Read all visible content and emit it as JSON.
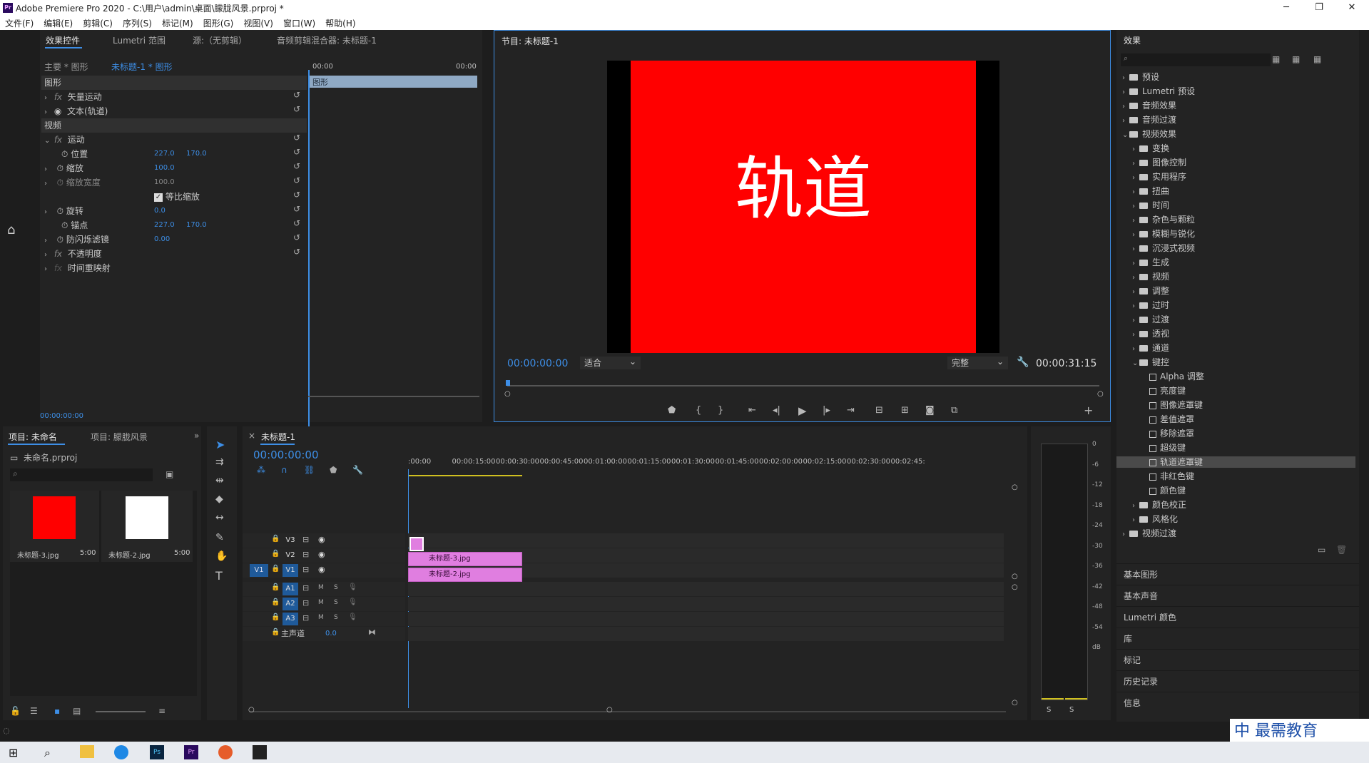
{
  "window": {
    "title": "Adobe Premiere Pro 2020 - C:\\用户\\admin\\桌面\\朦胧风景.prproj *",
    "app_icon": "Pr",
    "min": "─",
    "max": "❐",
    "close": "✕"
  },
  "menu": [
    "文件(F)",
    "编辑(E)",
    "剪辑(C)",
    "序列(S)",
    "标记(M)",
    "图形(G)",
    "视图(V)",
    "窗口(W)",
    "帮助(H)"
  ],
  "left_top_tabs": [
    "效果控件",
    "Lumetri 范围",
    "源:（无剪辑）",
    "音频剪辑混合器: 未标题-1"
  ],
  "effect_controls": {
    "master": "主要 * 图形",
    "sequence": "未标题-1 * 图形",
    "ruler_start": "00:00",
    "ruler_end": "00:00",
    "clip_label": "图形",
    "section_graphics": "图形",
    "vector_motion": "矢量运动",
    "text_item": "文本(轨道)",
    "section_video": "视频",
    "motion": "运动",
    "position": "位置",
    "position_x": "227.0",
    "position_y": "170.0",
    "scale": "缩放",
    "scale_v": "100.0",
    "scale_width": "缩放宽度",
    "scale_width_v": "100.0",
    "uniform_scale": "等比缩放",
    "rotation": "旋转",
    "rotation_v": "0.0",
    "anchor": "锚点",
    "anchor_x": "227.0",
    "anchor_y": "170.0",
    "flicker": "防闪烁滤镜",
    "flicker_v": "0.00",
    "opacity": "不透明度",
    "time_remap": "时间重映射",
    "fx": "fx",
    "timecode": "00:00:00:00"
  },
  "program": {
    "tab": "节目: 未标题-1",
    "text": "轨道",
    "timecode": "00:00:00:00",
    "fit": "适合",
    "quality": "完整",
    "duration": "00:00:31:15",
    "frame_color": "#ff0000"
  },
  "project": {
    "tabs": [
      "项目: 未命名",
      "项目: 朦胧风景"
    ],
    "file": "未命名.prproj",
    "items": [
      {
        "name": "未标题-3.jpg",
        "dur": "5:00",
        "color": "#ff0000"
      },
      {
        "name": "未标题-2.jpg",
        "dur": "5:00",
        "color": "#ffffff"
      }
    ]
  },
  "timeline": {
    "tab": "未标题-1",
    "timecode": "00:00:00:00",
    "ruler": [
      ":00:00",
      "00:00:15:00",
      "00:00:30:00",
      "00:00:45:00",
      "00:01:00:00",
      "00:01:15:00",
      "00:01:30:00",
      "00:01:45:00",
      "00:02:00:00",
      "00:02:15:00",
      "00:02:30:00",
      "00:02:45:"
    ],
    "video_tracks": [
      "V3",
      "V2",
      "V1"
    ],
    "audio_tracks": [
      "A1",
      "A2",
      "A3"
    ],
    "source_patch": "V1",
    "master": "主声道",
    "master_v": "0.0",
    "m": "M",
    "s": "S",
    "clips": [
      {
        "name": "未标题-3.jpg"
      },
      {
        "name": "未标题-2.jpg"
      }
    ]
  },
  "meter": {
    "scale": [
      "0",
      "-6",
      "-12",
      "-18",
      "-24",
      "-30",
      "-36",
      "-42",
      "-48",
      "-54",
      "dB"
    ],
    "solo": [
      "S",
      "S"
    ]
  },
  "effects": {
    "tab": "效果",
    "search_placeholder": "",
    "items": [
      {
        "label": "预设",
        "level": 0,
        "open": false
      },
      {
        "label": "Lumetri 预设",
        "level": 0,
        "open": false
      },
      {
        "label": "音频效果",
        "level": 0,
        "open": false
      },
      {
        "label": "音频过渡",
        "level": 0,
        "open": false
      },
      {
        "label": "视频效果",
        "level": 0,
        "open": true
      },
      {
        "label": "变换",
        "level": 1,
        "open": false
      },
      {
        "label": "图像控制",
        "level": 1,
        "open": false
      },
      {
        "label": "实用程序",
        "level": 1,
        "open": false
      },
      {
        "label": "扭曲",
        "level": 1,
        "open": false
      },
      {
        "label": "时间",
        "level": 1,
        "open": false
      },
      {
        "label": "杂色与颗粒",
        "level": 1,
        "open": false
      },
      {
        "label": "模糊与锐化",
        "level": 1,
        "open": false
      },
      {
        "label": "沉浸式视频",
        "level": 1,
        "open": false
      },
      {
        "label": "生成",
        "level": 1,
        "open": false
      },
      {
        "label": "视频",
        "level": 1,
        "open": false
      },
      {
        "label": "调整",
        "level": 1,
        "open": false
      },
      {
        "label": "过时",
        "level": 1,
        "open": false
      },
      {
        "label": "过渡",
        "level": 1,
        "open": false
      },
      {
        "label": "透视",
        "level": 1,
        "open": false
      },
      {
        "label": "通道",
        "level": 1,
        "open": false
      },
      {
        "label": "键控",
        "level": 1,
        "open": true
      },
      {
        "label": "Alpha 调整",
        "level": 2
      },
      {
        "label": "亮度键",
        "level": 2
      },
      {
        "label": "图像遮罩键",
        "level": 2
      },
      {
        "label": "差值遮罩",
        "level": 2
      },
      {
        "label": "移除遮罩",
        "level": 2
      },
      {
        "label": "超级键",
        "level": 2
      },
      {
        "label": "轨道遮罩键",
        "level": 2,
        "selected": true
      },
      {
        "label": "非红色键",
        "level": 2
      },
      {
        "label": "颜色键",
        "level": 2
      },
      {
        "label": "颜色校正",
        "level": 1,
        "open": false
      },
      {
        "label": "风格化",
        "level": 1,
        "open": false
      },
      {
        "label": "视频过渡",
        "level": 0,
        "open": false
      }
    ]
  },
  "side_panels": [
    "基本图形",
    "基本声音",
    "Lumetri 颜色",
    "库",
    "标记",
    "历史记录",
    "信息"
  ],
  "watermark": "中 最需教育"
}
